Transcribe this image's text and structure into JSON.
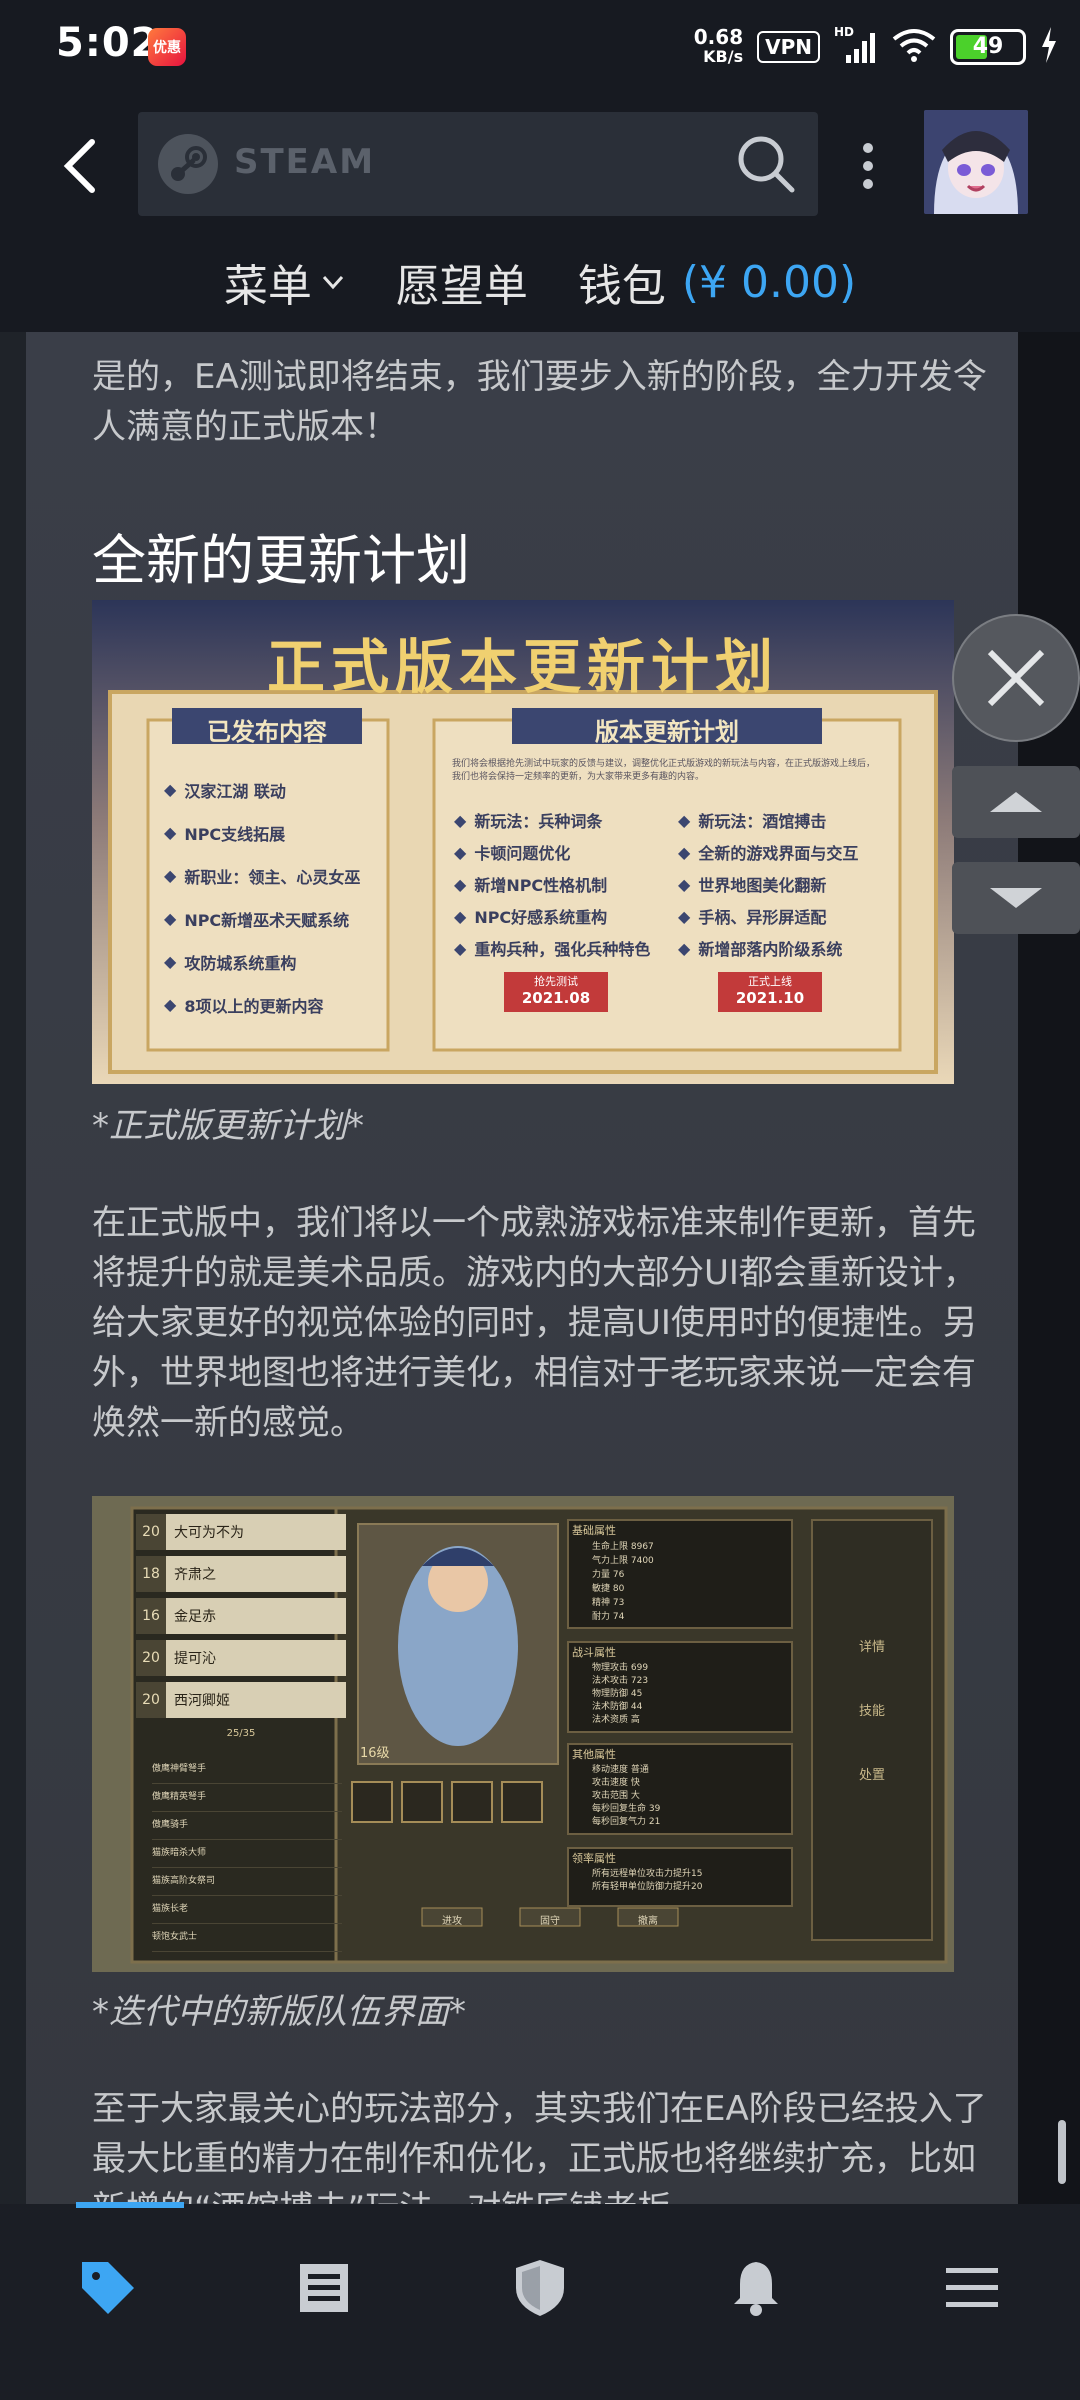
{
  "status": {
    "time": "5:02",
    "app_icon_text": "优惠",
    "net_speed_value": "0.68",
    "net_speed_unit": "KB/s",
    "vpn": "VPN",
    "signal_label": "HD",
    "battery": "49",
    "battery_level_percent": 49
  },
  "header": {
    "search_brand": "STEAM",
    "nav": {
      "menu": "菜单",
      "wishlist": "愿望单",
      "wallet": "钱包",
      "wallet_amount": "(¥ 0.00)"
    }
  },
  "content": {
    "intro": "是的，EA测试即将结束，我们要步入新的阶段，全力开发令人满意的正式版本！",
    "heading": "全新的更新计划",
    "plan_image": {
      "title": "正式版本更新计划",
      "left_title": "已发布内容",
      "left_items": [
        "汉家江湖 联动",
        "NPC支线拓展",
        "新职业：领主、心灵女巫",
        "NPC新增巫术天赋系统",
        "攻防城系统重构",
        "8项以上的更新内容"
      ],
      "right_title": "版本更新计划",
      "right_desc": "我们将会根据抢先测试中玩家的反馈与建议，调整优化正式版游戏的新玩法与内容，在正式版游戏上线后，我们也将会保持一定频率的更新，为大家带来更多有趣的内容。",
      "right_items_a": [
        "新玩法：兵种词条",
        "卡顿问题优化",
        "新增NPC性格机制",
        "NPC好感系统重构",
        "重构兵种，强化兵种特色"
      ],
      "right_items_b": [
        "新玩法：酒馆搏击",
        "全新的游戏界面与交互",
        "世界地图美化翻新",
        "手柄、异形屏适配",
        "新增部落内阶级系统"
      ],
      "stamp_left_label": "抢先测试",
      "stamp_left_date": "2021.08",
      "stamp_right_label": "正式上线",
      "stamp_right_date": "2021.10"
    },
    "caption1": "*正式版更新计划*",
    "para2": "在正式版中，我们将以一个成熟游戏标准来制作更新，首先将提升的就是美术品质。游戏内的大部分UI都会重新设计，给大家更好的视觉体验的同时，提高UI使用时的便捷性。另外，世界地图也将进行美化，相信对于老玩家来说一定会有焕然一新的感觉。",
    "team_image": {
      "roster": [
        {
          "level": "20",
          "name": "大可为不为"
        },
        {
          "level": "18",
          "name": "齐肃之"
        },
        {
          "level": "16",
          "name": "金足赤"
        },
        {
          "level": "20",
          "name": "提可沁"
        },
        {
          "level": "20",
          "name": "西河卿姬"
        }
      ],
      "count": "25/35",
      "units": [
        "傲鹰神臂弩手",
        "傲鹰精英弩手",
        "傲鹰骑手",
        "猫族暗杀大师",
        "猫族高阶女祭司",
        "猫族长老",
        "顿饱女武士"
      ],
      "hero_level": "16级",
      "panel_basic": "基础属性",
      "basic_stats": [
        {
          "label": "生命上限",
          "value": "8967"
        },
        {
          "label": "气力上限",
          "value": "7400"
        },
        {
          "label": "力量",
          "value": "76"
        },
        {
          "label": "敏捷",
          "value": "80"
        },
        {
          "label": "精神",
          "value": "73"
        },
        {
          "label": "耐力",
          "value": "74"
        }
      ],
      "panel_combat": "战斗属性",
      "combat_stats": [
        {
          "label": "物理攻击",
          "value": "699"
        },
        {
          "label": "法术攻击",
          "value": "723"
        },
        {
          "label": "物理防御",
          "value": "45"
        },
        {
          "label": "法术防御",
          "value": "44"
        },
        {
          "label": "法术资质",
          "value": "高"
        }
      ],
      "panel_other": "其他属性",
      "other_stats": [
        {
          "label": "移动速度",
          "value": "普通"
        },
        {
          "label": "攻击速度",
          "value": "快"
        },
        {
          "label": "攻击范围",
          "value": "大"
        },
        {
          "label": "每秒回复生命",
          "value": "39"
        },
        {
          "label": "每秒回复气力",
          "value": "21"
        }
      ],
      "panel_leader": "领率属性",
      "leader_lines": [
        "所有远程单位攻击力提升15",
        "所有轻甲单位防御力提升20"
      ],
      "side_tabs": [
        "详情",
        "技能",
        "处置"
      ],
      "buttons": [
        "进攻",
        "固守",
        "撤离"
      ]
    },
    "caption2": "*迭代中的新版队伍界面*",
    "para3": "至于大家最关心的玩法部分，其实我们在EA阶段已经投入了最大比重的精力在制作和优化，正式版也将继续扩充，比如新增的“酒馆搏击”玩法，对铁匠铺老板"
  },
  "colors": {
    "accent": "#3da6f3",
    "header_bg": "#171a21",
    "content_bg": "#3a3e48"
  },
  "icons": {
    "back": "back-arrow-icon",
    "search": "search-icon",
    "more": "kebab-menu-icon",
    "close": "close-icon",
    "up": "triangle-up-icon",
    "down": "triangle-down-icon",
    "bottom_nav": [
      "store-tag-icon",
      "news-icon",
      "shield-icon",
      "bell-icon",
      "hamburger-menu-icon"
    ]
  }
}
